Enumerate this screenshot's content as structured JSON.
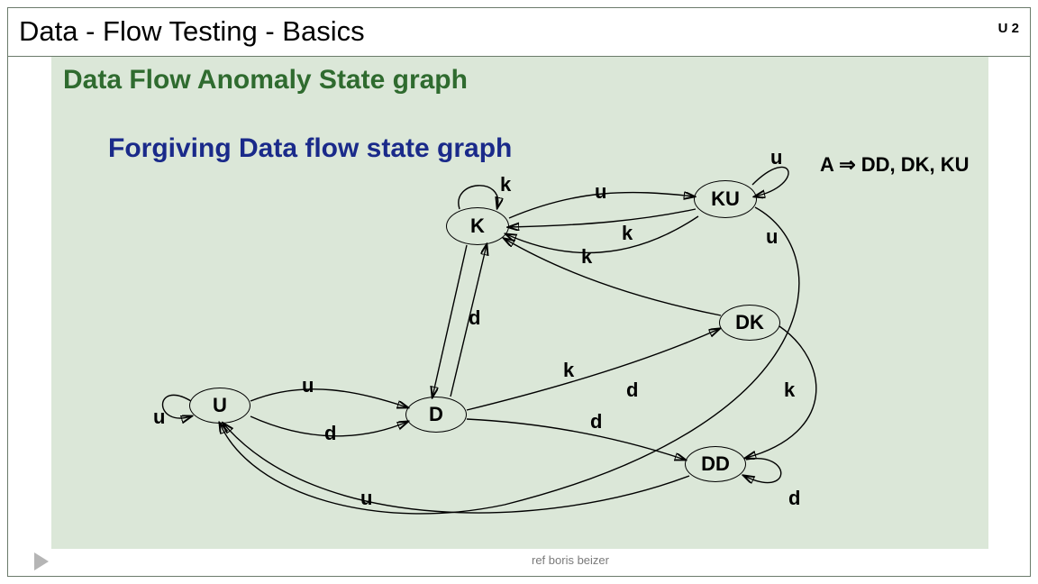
{
  "header": {
    "title": "Data - Flow Testing   -   Basics",
    "unit": "U 2"
  },
  "subtitle": "Data Flow Anomaly State graph",
  "heading3": "Forgiving Data flow state graph",
  "anomaly": {
    "prefix": "A",
    "arrow": "⇒",
    "list": "DD, DK, KU"
  },
  "nodes": {
    "K": "K",
    "KU": "KU",
    "DK": "DK",
    "D": "D",
    "U": "U",
    "DD": "DD"
  },
  "edges": {
    "k_top": "k",
    "u_KtoKU": "u",
    "u_KUloop": "u",
    "k_KUtoK_upper": "k",
    "k_KUtoK_lower": "k",
    "u_KUtoU": "u",
    "d_KtoD": "d",
    "k_DtoK": "k",
    "d_DtoDK": "d",
    "k_DKtoK": "k",
    "u_UtoD": "u",
    "d_UtoD": "d",
    "d_DtoDD": "d",
    "u_Uloop": "u",
    "u_DDtoU": "u",
    "d_DDloop": "d",
    "DK_label": "DK"
  },
  "footer": {
    "ref": "ref boris beizer"
  },
  "colors": {
    "panel": "#dbe7d8",
    "subtitle": "#2f6b2f",
    "heading": "#1a2a8a"
  }
}
